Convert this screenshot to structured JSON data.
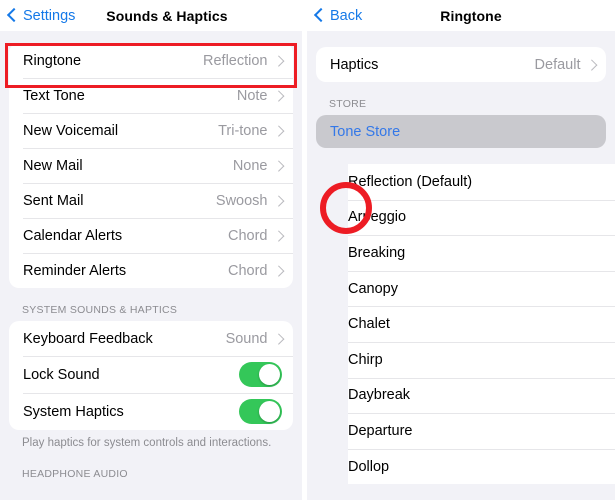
{
  "left_panel": {
    "nav": {
      "back_label": "Settings",
      "back_icon": "chevron-left-icon",
      "title": "Sounds & Haptics"
    },
    "sound_rows": [
      {
        "label": "Ringtone",
        "value": "Reflection"
      },
      {
        "label": "Text Tone",
        "value": "Note"
      },
      {
        "label": "New Voicemail",
        "value": "Tri-tone"
      },
      {
        "label": "New Mail",
        "value": "None"
      },
      {
        "label": "Sent Mail",
        "value": "Swoosh"
      },
      {
        "label": "Calendar Alerts",
        "value": "Chord"
      },
      {
        "label": "Reminder Alerts",
        "value": "Chord"
      }
    ],
    "system_section": {
      "header": "SYSTEM SOUNDS & HAPTICS",
      "rows": [
        {
          "label": "Keyboard Feedback",
          "value": "Sound",
          "type": "disclosure"
        },
        {
          "label": "Lock Sound",
          "value": "on",
          "type": "toggle"
        },
        {
          "label": "System Haptics",
          "value": "on",
          "type": "toggle"
        }
      ],
      "footer": "Play haptics for system controls and interactions."
    },
    "headphone_section": {
      "header": "HEADPHONE AUDIO"
    }
  },
  "right_panel": {
    "nav": {
      "back_label": "Back",
      "back_icon": "chevron-left-icon",
      "title": "Ringtone"
    },
    "haptics_row": {
      "label": "Haptics",
      "value": "Default"
    },
    "store_section": {
      "header": "STORE",
      "item_label": "Tone Store"
    },
    "tones": [
      {
        "label": "Reflection (Default)",
        "selected": true
      },
      {
        "label": "Arpeggio",
        "selected": false
      },
      {
        "label": "Breaking",
        "selected": false
      },
      {
        "label": "Canopy",
        "selected": false
      },
      {
        "label": "Chalet",
        "selected": false
      },
      {
        "label": "Chirp",
        "selected": false
      },
      {
        "label": "Daybreak",
        "selected": false
      },
      {
        "label": "Departure",
        "selected": false
      },
      {
        "label": "Dollop",
        "selected": false
      }
    ]
  },
  "annotations": {
    "highlight_box_target": "Ringtone",
    "highlight_circle_target": "Reflection (Default) checkmark",
    "color": "#ED1C24"
  },
  "colors": {
    "accent_blue": "#1579E8",
    "link_blue": "#3478E8",
    "toggle_green": "#34C759",
    "background": "#F2F2F7",
    "card": "#FFFFFF",
    "secondary_text": "#8C8C91",
    "annotation_red": "#ED1C24"
  }
}
